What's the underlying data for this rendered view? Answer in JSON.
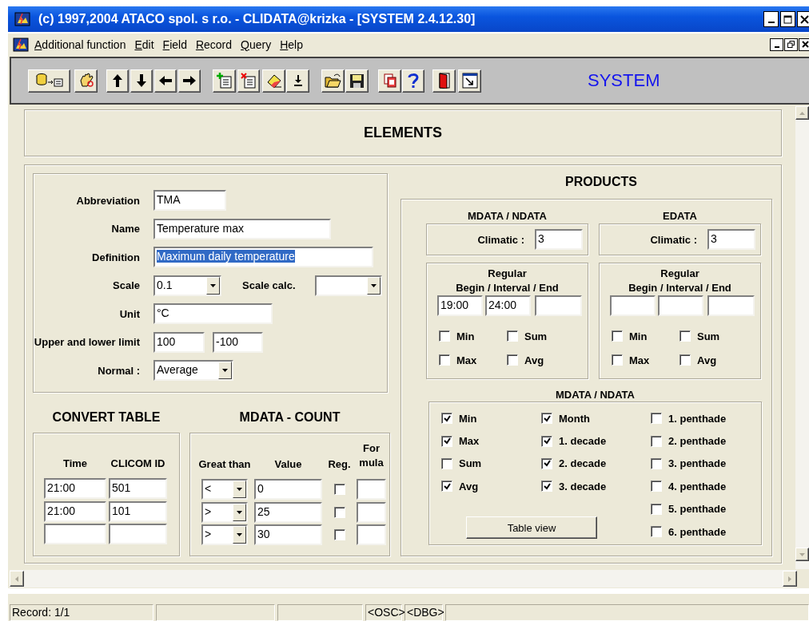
{
  "window": {
    "title": "(c) 1997,2004 ATACO spol. s r.o. - CLIDATA@krizka - [SYSTEM 2.4.12.30]"
  },
  "menu": [
    {
      "label": "Additional function"
    },
    {
      "label": "Edit"
    },
    {
      "label": "Field"
    },
    {
      "label": "Record"
    },
    {
      "label": "Query"
    },
    {
      "label": "Help"
    }
  ],
  "toolbar": {
    "module": "SYSTEM"
  },
  "form": {
    "title": "ELEMENTS",
    "fields": [
      {
        "label": "Abbreviation",
        "controls": [
          {
            "kind": "text",
            "value": "TMA",
            "highlighted": false
          }
        ]
      },
      {
        "label": "Name",
        "controls": [
          {
            "kind": "text",
            "value": "Temperature max",
            "highlighted": false
          }
        ]
      },
      {
        "label": "Definition",
        "controls": [
          {
            "kind": "text",
            "value": "Maximum daily temperature",
            "highlighted": true
          }
        ]
      },
      {
        "label": "Scale",
        "controls": [
          {
            "kind": "dropdown",
            "value": "0.1"
          },
          {
            "kind": "label",
            "text": "Scale calc."
          },
          {
            "kind": "dropdown"
          }
        ]
      },
      {
        "label": "Unit",
        "controls": [
          {
            "kind": "text",
            "value": "°C",
            "highlighted": false
          }
        ]
      },
      {
        "label": "Upper and lower limit",
        "controls": [
          {
            "kind": "text",
            "value": "100",
            "highlighted": false
          },
          {
            "kind": "text",
            "value": "-100",
            "highlighted": false
          }
        ]
      },
      {
        "label": "Normal :",
        "controls": [
          {
            "kind": "dropdown",
            "value": "Average"
          }
        ]
      }
    ]
  },
  "convert_table": {
    "title": "CONVERT TABLE",
    "columns": [
      "Time",
      "CLICOM ID"
    ],
    "rows": [
      {
        "time": "21:00",
        "clicom_id": "501"
      },
      {
        "time": "21:00",
        "clicom_id": "101"
      }
    ]
  },
  "mdata_count": {
    "title": "MDATA - COUNT",
    "columns": [
      "Great than",
      "Value",
      "Reg.",
      "For mula"
    ],
    "rows": [
      {
        "operator": "<",
        "value": "0",
        "reg": false
      },
      {
        "operator": ">",
        "value": "25",
        "reg": false
      },
      {
        "operator": ">",
        "value": "30",
        "reg": false
      }
    ]
  },
  "products": {
    "title": "PRODUCTS",
    "groups": [
      {
        "title": "MDATA / NDATA",
        "climatic_label": "Climatic :",
        "climatic": "3",
        "regular_title": "Regular",
        "regular_subtitle": "Begin / Interval / End",
        "times": [
          "19:00",
          "24:00"
        ],
        "checks": [
          {
            "label": "Min",
            "checked": false
          },
          {
            "label": "Sum",
            "checked": false
          },
          {
            "label": "Max",
            "checked": false
          },
          {
            "label": "Avg",
            "checked": false
          }
        ]
      },
      {
        "title": "EDATA",
        "climatic_label": "Climatic :",
        "climatic": "3",
        "regular_title": "Regular",
        "regular_subtitle": "Begin / Interval / End",
        "checks": [
          {
            "label": "Min",
            "checked": false
          },
          {
            "label": "Sum",
            "checked": false
          },
          {
            "label": "Max",
            "checked": false
          },
          {
            "label": "Avg",
            "checked": false
          }
        ]
      }
    ],
    "summary": {
      "title": "MDATA / NDATA",
      "columns": [
        [
          {
            "label": "Min",
            "checked": true
          },
          {
            "label": "Max",
            "checked": true
          },
          {
            "label": "Sum",
            "checked": false
          },
          {
            "label": "Avg",
            "checked": true
          }
        ],
        [
          {
            "label": "Month",
            "checked": true
          },
          {
            "label": "1. decade",
            "checked": true
          },
          {
            "label": "2. decade",
            "checked": true
          },
          {
            "label": "3. decade",
            "checked": true
          }
        ],
        [
          {
            "label": "1. penthade",
            "checked": false
          },
          {
            "label": "2. penthade",
            "checked": false
          },
          {
            "label": "3. penthade",
            "checked": false
          },
          {
            "label": "4. penthade",
            "checked": false
          },
          {
            "label": "5. penthade",
            "checked": false
          },
          {
            "label": "6. penthade",
            "checked": false
          }
        ]
      ],
      "button": "Table view"
    }
  },
  "status_bar": [
    {
      "text": "Record: 1/1"
    },
    {
      "text": "<OSC>"
    },
    {
      "text": "<DBG>"
    }
  ]
}
